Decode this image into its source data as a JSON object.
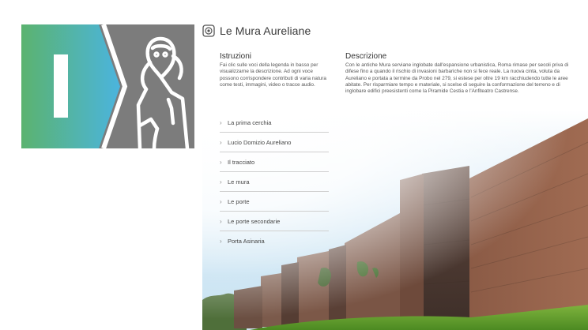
{
  "header": {
    "title": "Le Mura Aureliane",
    "icon": "audio-guide-icon"
  },
  "logo": {
    "icon_left": "roman-numeral-one",
    "icon_right": "woman-portrait-outline",
    "colors": [
      "#5bb36f",
      "#4bb4de",
      "#7c7c7c"
    ]
  },
  "istruzioni": {
    "heading": "Istruzioni",
    "lines": [
      "Fai clic sulle voci della legenda in basso per",
      "visualizzarne la descrizione. Ad ogni voce",
      "possono corrispondere contributi di varia natura",
      "come testi, immagini, video o tracce audio."
    ]
  },
  "descrizione": {
    "heading": "Descrizione",
    "lines": [
      "Con le antiche Mura serviane inglobate dall'espansione urbanistica, Roma rimase per secoli priva di",
      "difese fino a quando il rischio di invasioni barbariche non si fece reale. La nuova cinta, voluta da",
      "Aureliano e portata a termine da Probo nel 279, si estese per oltre 19 km racchiudendo tutte le aree",
      "abitate. Per risparmiare tempo e materiale, si scelse di seguire la conformazione del terreno e di",
      "inglobare edifici preesistenti come la Piramide Cestia e l'Anfiteatro Castrense."
    ]
  },
  "menu": {
    "items": [
      "La prima cerchia",
      "Lucio Domizio Aureliano",
      "Il tracciato",
      "Le mura",
      "Le porte",
      "Le porte secondarie",
      "Porta Asinaria"
    ]
  }
}
